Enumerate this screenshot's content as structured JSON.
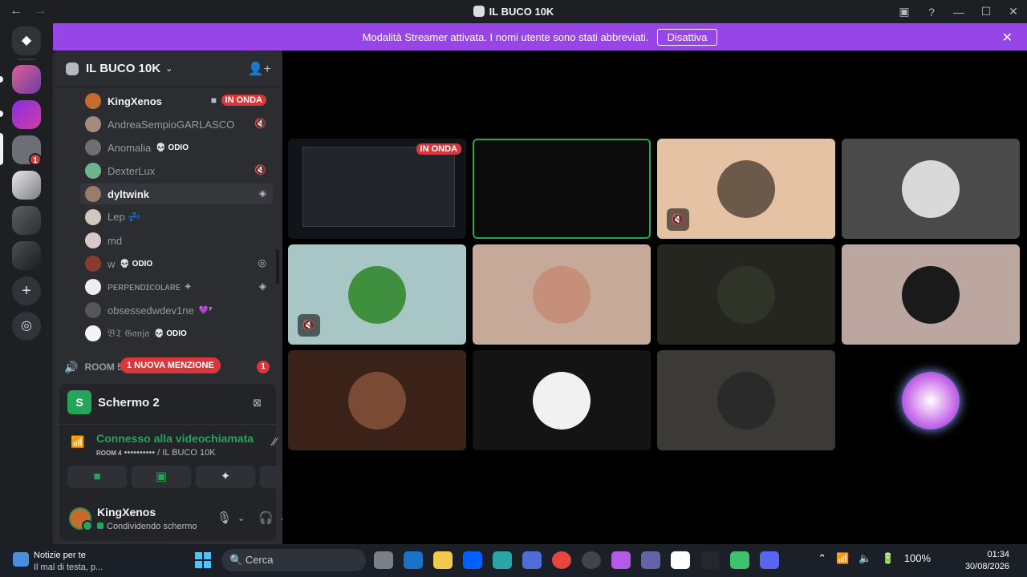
{
  "titlebar": {
    "title": "IL BUCO 10K",
    "back": "←",
    "forward": "→"
  },
  "banner": {
    "text": "Modalità Streamer attivata. I nomi utente sono stati abbreviati.",
    "button": "Disattiva"
  },
  "guilds": {
    "mention_count": "1"
  },
  "server": {
    "name": "IL BUCO 10K"
  },
  "members": [
    {
      "name": "KingXenos",
      "bright": true,
      "badge": "IN ONDA"
    },
    {
      "name": "AndreaSempioGARLASCO",
      "bright": false
    },
    {
      "name": "Anomalia",
      "bright": false,
      "tag": "💀 ODIO"
    },
    {
      "name": "DexterLux",
      "bright": false
    },
    {
      "name": "dyltwink",
      "bright": true
    },
    {
      "name": "Lep 💤",
      "bright": false
    },
    {
      "name": "md",
      "bright": false
    },
    {
      "name": "w",
      "bright": false,
      "tag": "💀 ODIO"
    },
    {
      "name": "ᴘᴇʀᴘᴇɴᴅɪᴄᴏʟᴀʀᴇ ✦",
      "bright": false
    },
    {
      "name": "obsessedwdev1ne",
      "bright": false,
      "tag": "💜⁷"
    },
    {
      "name": "𝔅𝔗 𝔊𝔞𝔫𝔧𝔞",
      "bright": false,
      "tag": "💀 ODIO"
    }
  ],
  "room": {
    "label": "ROOM 5",
    "mention": "1 NUOVA MENZIONE",
    "count": "1"
  },
  "screen": {
    "badge": "S",
    "title": "Schermo 2"
  },
  "connection": {
    "status": "Connesso alla videochiamata",
    "room": "ROOM 4",
    "dots": "••••••••••",
    "server": "/ IL BUCO 10K"
  },
  "user": {
    "name": "KingXenos",
    "status": "Condividendo schermo"
  },
  "tiles": [
    {
      "live": "IN ONDA"
    },
    {},
    {},
    {},
    {},
    {},
    {},
    {},
    {},
    {},
    {},
    {}
  ],
  "taskbar": {
    "news_title": "Notizie per te",
    "news_sub": "Il mal di testa, p...",
    "search_placeholder": "Cerca",
    "battery": "100%",
    "time": "01:34",
    "date": "30/08/2026"
  },
  "colors": {
    "accent": "#9845e8",
    "green": "#23a55a",
    "red": "#da373c",
    "background": "#000000"
  }
}
